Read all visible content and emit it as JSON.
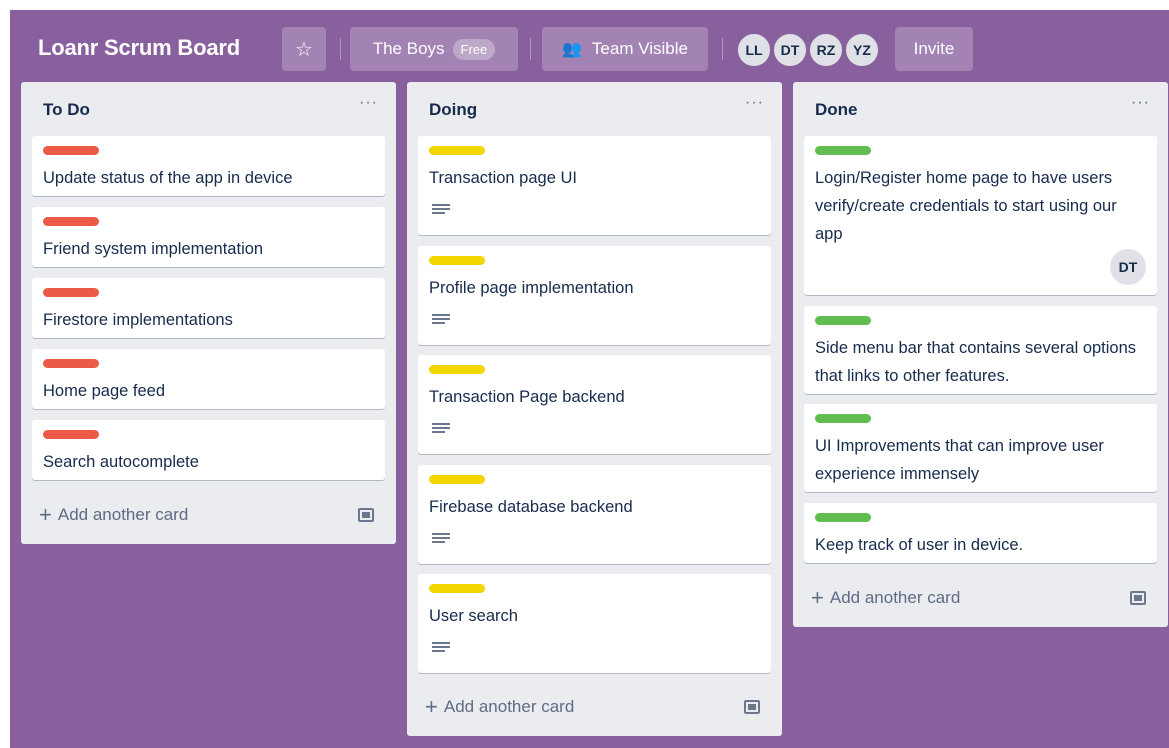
{
  "board": {
    "title": "Loanr Scrum Board",
    "star_icon": "star-icon",
    "team_name": "The Boys",
    "team_badge": "Free",
    "visibility_icon": "team-icon",
    "visibility_label": "Team Visible",
    "members": [
      "LL",
      "DT",
      "RZ",
      "YZ"
    ],
    "invite_label": "Invite",
    "background_color": "#89609e"
  },
  "lists": [
    {
      "title": "To Do",
      "menu": "···",
      "label_color": "#eb5a46",
      "cards": [
        "Update status of the app in device",
        "Friend system implementation",
        "Firestore implementations",
        "Home page feed",
        "Search autocomplete"
      ],
      "add_label": "Add another card"
    },
    {
      "title": "Doing",
      "menu": "···",
      "label_color": "#f2d600",
      "cards": [
        "Transaction page UI",
        "Profile page implementation",
        "Transaction Page backend",
        "Firebase database backend",
        "User search"
      ],
      "add_label": "Add another card"
    },
    {
      "title": "Done",
      "menu": "···",
      "label_color": "#61bd4f",
      "cards": [
        "Login/Register home page to have users verify/create credentials to start using our app",
        "Side menu bar that contains several options that links to other features.",
        "UI Improvements that can improve user experience immensely",
        "Keep track of user in device."
      ],
      "card_member": "DT",
      "add_label": "Add another card"
    }
  ]
}
